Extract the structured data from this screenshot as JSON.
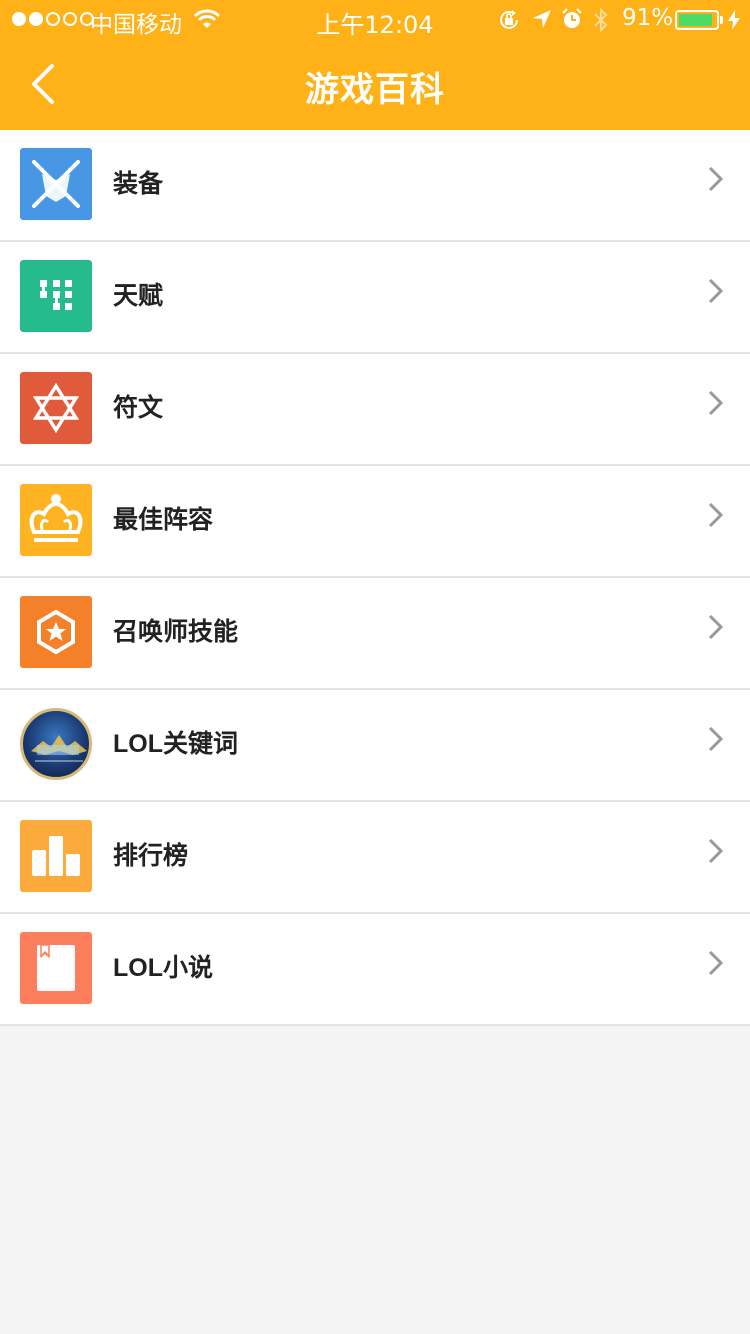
{
  "status": {
    "carrier": "中国移动",
    "time": "上午12:04",
    "battery": "91%",
    "battery_level": 0.91
  },
  "header": {
    "title": "游戏百科"
  },
  "items": [
    {
      "label": "装备",
      "icon": "equipment-icon",
      "color": "#4797e5"
    },
    {
      "label": "天赋",
      "icon": "talent-icon",
      "color": "#26bb8c"
    },
    {
      "label": "符文",
      "icon": "rune-star-icon",
      "color": "#e05b3c"
    },
    {
      "label": "最佳阵容",
      "icon": "crown-icon",
      "color": "#feb322"
    },
    {
      "label": "召唤师技能",
      "icon": "summoner-skill-icon",
      "color": "#f3812a"
    },
    {
      "label": "LOL关键词",
      "icon": "lol-keyword-logo-icon",
      "color": "#1b3b73"
    },
    {
      "label": "排行榜",
      "icon": "ranking-chart-icon",
      "color": "#fdaa3c"
    },
    {
      "label": "LOL小说",
      "icon": "novel-book-icon",
      "color": "#fd7e5c"
    }
  ]
}
